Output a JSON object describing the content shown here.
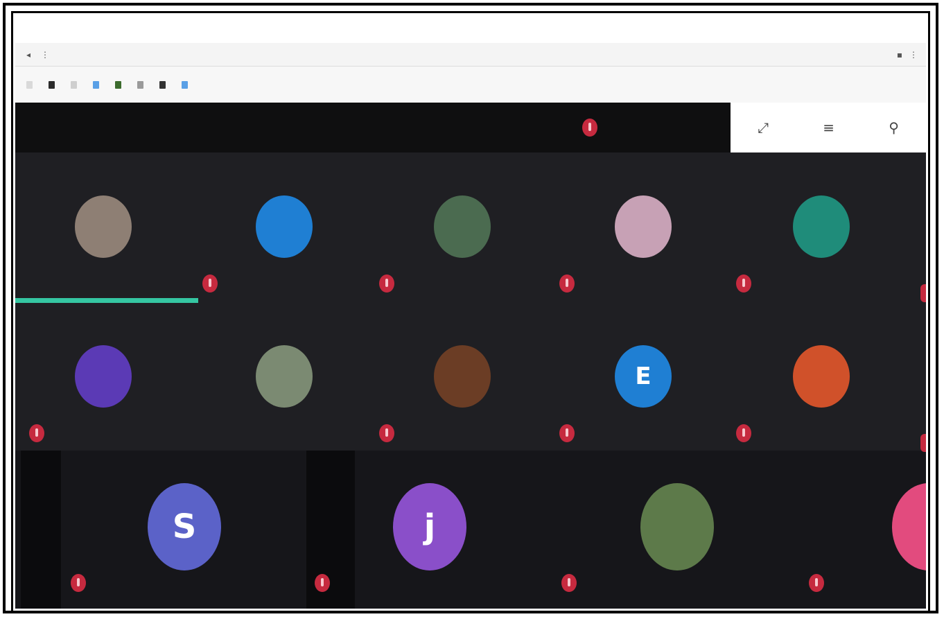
{
  "browser": {
    "url": "",
    "menu_icons": [
      "puzzle-icon",
      "kebab-icon"
    ],
    "bookmarks": [
      {
        "label": "",
        "color": "#d9d9d9"
      },
      {
        "label": "",
        "color": "#2b2b2b"
      },
      {
        "label": "",
        "color": "#cfcfcf"
      },
      {
        "label": "",
        "color": "#5aa0e6"
      },
      {
        "label": "",
        "color": "#3c6b2d"
      },
      {
        "label": "",
        "color": "#9a9a9a"
      },
      {
        "label": "",
        "color": "#333333"
      },
      {
        "label": "",
        "color": "#5aa0e6"
      }
    ]
  },
  "header": {
    "user": {
      "line1": "",
      "line2": ""
    },
    "tools": [
      "expand-icon",
      "list-icon",
      "person-icon"
    ]
  },
  "participants": {
    "row1": [
      {
        "name": "",
        "initial": "",
        "color": "#8e7f74",
        "muted": false,
        "speaking": true
      },
      {
        "name": "",
        "initial": "",
        "color": "#1f7fd3",
        "muted": true
      },
      {
        "name": "",
        "initial": "",
        "color": "#4b6b50",
        "muted": true
      },
      {
        "name": "",
        "initial": "",
        "color": "#c7a1b5",
        "muted": true
      },
      {
        "name": "",
        "initial": "",
        "color": "#1f8c7a",
        "muted": true
      }
    ],
    "row2": [
      {
        "name": "",
        "initial": "",
        "color": "#5b3ab5",
        "muted": true
      },
      {
        "name": "",
        "initial": "",
        "color": "#7b8a72",
        "muted": false
      },
      {
        "name": "",
        "initial": "",
        "color": "#6b3d25",
        "muted": true
      },
      {
        "name": "",
        "initial": "E",
        "color": "#1f7fd3",
        "muted": true
      },
      {
        "name": "",
        "initial": "",
        "color": "#d0512a",
        "muted": true
      }
    ],
    "row3": [
      {
        "name": "",
        "initial": "S",
        "color": "#5b62c8",
        "muted": true
      },
      {
        "name": "",
        "initial": "j",
        "color": "#8a4fc9",
        "muted": true
      },
      {
        "name": "",
        "initial": "",
        "color": "#5d7a4a",
        "muted": true
      },
      {
        "name": "",
        "initial": "",
        "color": "#e24b7e",
        "muted": true
      }
    ]
  }
}
